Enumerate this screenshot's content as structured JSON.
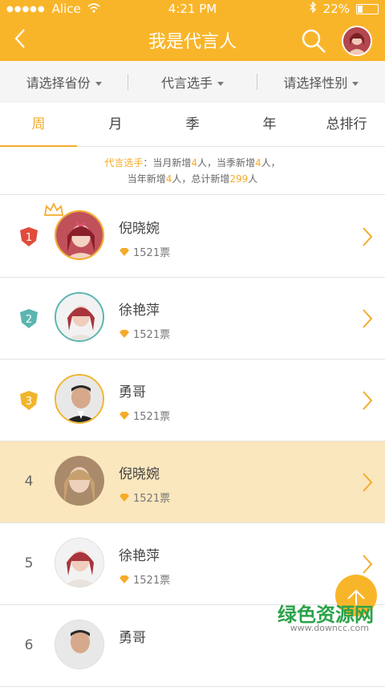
{
  "status_bar": {
    "dots": "●●●●●",
    "carrier": "Alice",
    "time": "4:21 PM",
    "battery": "22%",
    "battery_level": 0.22
  },
  "header": {
    "title": "我是代言人"
  },
  "filters": [
    {
      "label": "请选择省份"
    },
    {
      "label": "代言选手"
    },
    {
      "label": "请选择性别"
    }
  ],
  "tabs": [
    {
      "label": "周",
      "active": true
    },
    {
      "label": "月",
      "active": false
    },
    {
      "label": "季",
      "active": false
    },
    {
      "label": "年",
      "active": false
    },
    {
      "label": "总排行",
      "active": false
    }
  ],
  "summary": {
    "prefix": "代言选手",
    "l1a": "：当月新增",
    "month_count": "4",
    "l1b": "人，当季新增",
    "quarter_count": "4",
    "l1c": "人，",
    "l2a": "当年新增",
    "year_count": "4",
    "l2b": "人，总计新增",
    "total_count": "299",
    "l2c": "人"
  },
  "rows": [
    {
      "rank": "1",
      "name": "倪晓婉",
      "votes": "1521票"
    },
    {
      "rank": "2",
      "name": "徐艳萍",
      "votes": "1521票"
    },
    {
      "rank": "3",
      "name": "勇哥",
      "votes": "1521票"
    },
    {
      "rank": "4",
      "name": "倪晓婉",
      "votes": "1521票"
    },
    {
      "rank": "5",
      "name": "徐艳萍",
      "votes": "1521票"
    },
    {
      "rank": "6",
      "name": "勇哥",
      "votes": ""
    }
  ],
  "watermark": {
    "text": "绿色资源网",
    "url": "www.downcc.com"
  },
  "colors": {
    "accent": "#f9b52a",
    "rank1": "#e04b3c",
    "rank2": "#5bb5b0",
    "rank3": "#f0b52c",
    "highlight_row": "#fbe7bd"
  }
}
